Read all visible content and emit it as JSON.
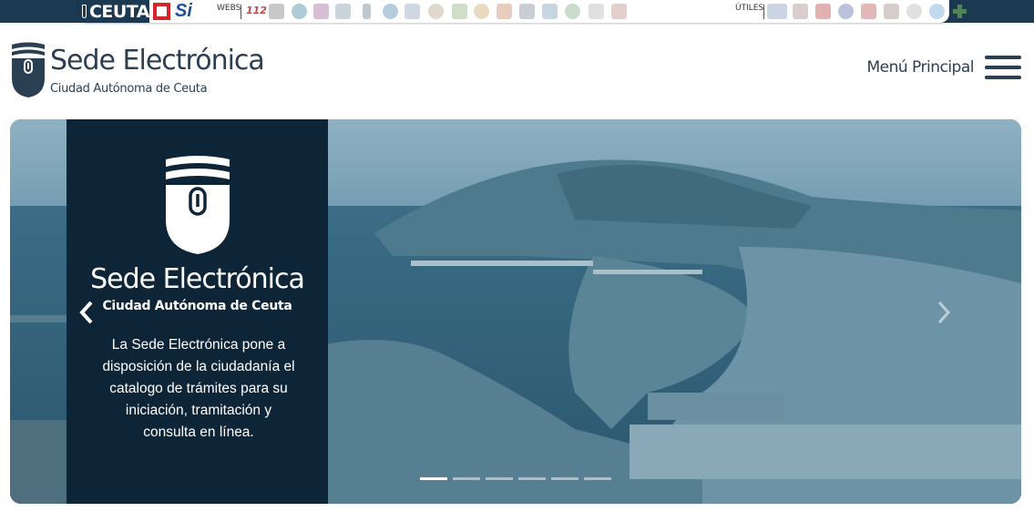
{
  "topbar": {
    "brand": "CEUTA",
    "si_logo": "Si",
    "webs_label": "WEBS",
    "n112": "112",
    "utiles_label": "ÚTILES",
    "icons": [
      "a-icon",
      "globe-icon",
      "asce-icon",
      "boat-icon",
      "tower-icon",
      "at-icon",
      "crest-icon",
      "leaf-icon",
      "trophy-icon",
      "seal-icon",
      "m-icon",
      "bank-icon",
      "flag-icon",
      "building-icon",
      "document-icon",
      "emblem-icon"
    ],
    "util_icons": [
      "card-icon",
      "crest-icon",
      "r-icon",
      "seal-icon",
      "emblem-icon",
      "map-icon",
      "circle-icon",
      "globe-icon",
      "plus-icon"
    ]
  },
  "header": {
    "title": "Sede Electrónica",
    "subtitle": "Ciudad Autónoma de Ceuta",
    "menu_label": "Menú Principal"
  },
  "hero": {
    "title": "Sede Electrónica",
    "subtitle": "Ciudad Autónoma de Ceuta",
    "description": "La Sede Electrónica pone a disposición de la ciudadanía el catalogo de trámites para su iniciación, tramitación y consulta en línea.",
    "slide_count": 6,
    "active_slide": 1
  }
}
